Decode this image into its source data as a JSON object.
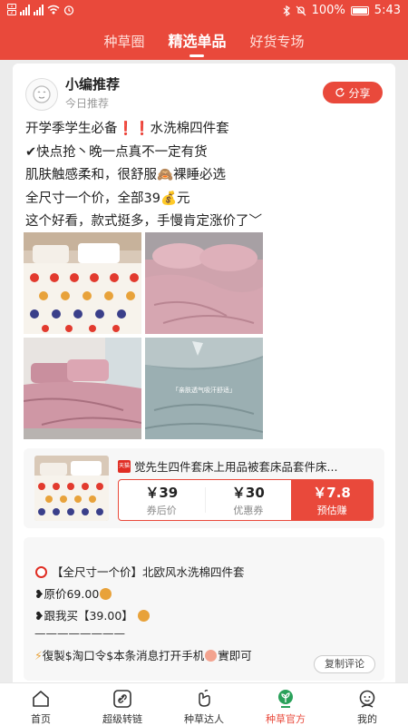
{
  "status_bar": {
    "battery": "100%",
    "time": "5:43"
  },
  "tabs": [
    {
      "label": "种草圈",
      "active": false
    },
    {
      "label": "精选单品",
      "active": true
    },
    {
      "label": "好货专场",
      "active": false
    }
  ],
  "post": {
    "author": "小编推荐",
    "subtitle": "今日推荐",
    "share_label": "分享",
    "lines": [
      "开学季学生必备❗❗水洗棉四件套",
      "✔快点抢丶晚一点真不一定有货",
      "肌肤触感柔和，很舒服🙈裸睡必选",
      "全尺寸一个价，全部39💰元",
      "这个好看，款式挺多，手慢肯定涨价了﹀"
    ],
    "image_overlay_text": "「亲肤透气吸汗舒适」"
  },
  "product": {
    "shop_badge": "天猫",
    "title": "觉先生四件套床上用品被套床品套件床...",
    "coupon_price": "￥39",
    "coupon_price_label": "券后价",
    "coupon": "￥30",
    "coupon_label": "优惠券",
    "earn": "￥7.8",
    "earn_label": "预估赚"
  },
  "comment": {
    "line1": "【全尺寸一个价】北欧风水洗棉四件套",
    "line2": "原价69.00",
    "line3": "跟我买【39.00】",
    "line4": "————————",
    "line5": "復製$淘口令$本条消息打开手机",
    "line5_tail": "實即可",
    "copy_label": "复制评论"
  },
  "bottom_nav": [
    {
      "label": "首页",
      "icon": "home-icon"
    },
    {
      "label": "超级转链",
      "icon": "link-icon"
    },
    {
      "label": "种草达人",
      "icon": "hand-icon"
    },
    {
      "label": "种草官方",
      "icon": "sprout-icon",
      "active": true
    },
    {
      "label": "我的",
      "icon": "profile-icon"
    }
  ],
  "colors": {
    "brand": "#e9493b",
    "background": "#ececec"
  }
}
